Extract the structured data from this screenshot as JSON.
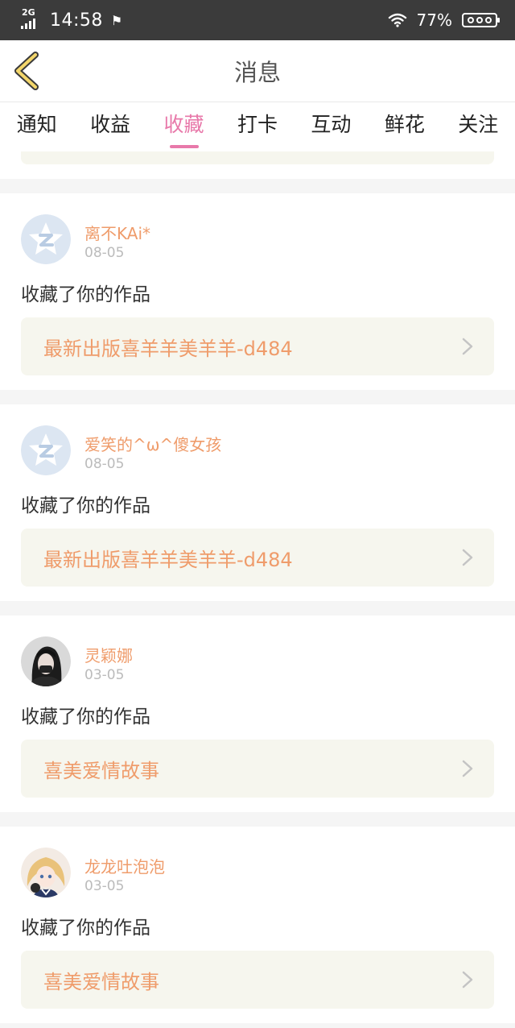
{
  "status_bar": {
    "network": "2G",
    "time": "14:58",
    "battery_percent": "77%"
  },
  "header": {
    "title": "消息"
  },
  "tabs": [
    {
      "label": "通知",
      "active": false
    },
    {
      "label": "收益",
      "active": false
    },
    {
      "label": "收藏",
      "active": true
    },
    {
      "label": "打卡",
      "active": false
    },
    {
      "label": "互动",
      "active": false
    },
    {
      "label": "鲜花",
      "active": false
    },
    {
      "label": "关注",
      "active": false
    }
  ],
  "colors": {
    "accent_pink": "#e879aa",
    "accent_orange": "#ef9c6b",
    "card_box": "#f6f6ee",
    "status_bar": "#3b3b3b"
  },
  "notifications": [
    {
      "user": "离不KAi*",
      "date": "08-05",
      "action": "收藏了你的作品",
      "work_title": "最新出版喜羊羊美羊羊-d484",
      "avatar": "qq-default-avatar-icon"
    },
    {
      "user": "爱笑的^ω^傻女孩",
      "date": "08-05",
      "action": "收藏了你的作品",
      "work_title": "最新出版喜羊羊美羊羊-d484",
      "avatar": "qq-default-avatar-icon"
    },
    {
      "user": "灵颖娜",
      "date": "03-05",
      "action": "收藏了你的作品",
      "work_title": "喜美爱情故事",
      "avatar": "dark-hair-user-avatar"
    },
    {
      "user": "龙龙吐泡泡",
      "date": "03-05",
      "action": "收藏了你的作品",
      "work_title": "喜美爱情故事",
      "avatar": "anime-girl-avatar"
    }
  ]
}
